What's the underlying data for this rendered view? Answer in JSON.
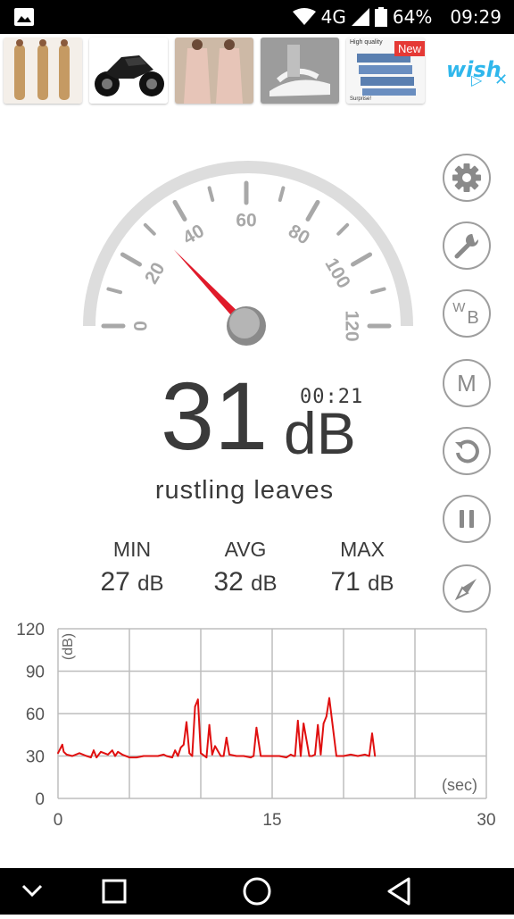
{
  "status_bar": {
    "network": "4G",
    "battery": "64%",
    "time": "09:29",
    "icons": [
      "gallery-icon",
      "wifi-icon",
      "signal-icon",
      "battery-icon"
    ]
  },
  "ad_banner": {
    "new_badge": "New",
    "high_quality_text": "High quality",
    "surprise_text": "Surprise!",
    "brand": "wish",
    "icons": [
      "adchoices-icon",
      "close-icon"
    ]
  },
  "gauge": {
    "min": 0,
    "max": 120,
    "tick_labels": [
      "0",
      "20",
      "40",
      "60",
      "80",
      "100",
      "120"
    ],
    "needle_value": 31
  },
  "reading": {
    "value": "31",
    "unit": "dB",
    "timer": "00:21",
    "description": "rustling leaves"
  },
  "stats": {
    "min_label": "MIN",
    "min_value": "27",
    "min_unit": "dB",
    "avg_label": "AVG",
    "avg_value": "32",
    "avg_unit": "dB",
    "max_label": "MAX",
    "max_value": "71",
    "max_unit": "dB"
  },
  "side_buttons": [
    "settings",
    "wrench",
    "WB",
    "M",
    "reset",
    "pause",
    "compass"
  ],
  "side_labels": {
    "wb_w": "W",
    "wb_b": "B",
    "m": "M"
  },
  "chart_data": {
    "type": "line",
    "y_tick_labels": [
      "120",
      "90",
      "60",
      "30",
      "0"
    ],
    "x_tick_labels": [
      "0",
      "15",
      "30"
    ],
    "ylabel": "(dB)",
    "xlabel": "(sec)",
    "xlim": [
      0,
      30
    ],
    "ylim": [
      0,
      120
    ],
    "grid": true,
    "color": "#e01010",
    "series": [
      {
        "x": [
          0,
          0.3,
          0.4,
          0.6,
          1.0,
          1.5,
          2.0,
          2.3,
          2.5,
          2.7,
          3.0,
          3.5,
          3.8,
          4.0,
          4.2,
          4.5,
          5.0,
          5.5,
          6.0,
          6.5,
          7.0,
          7.4,
          7.6,
          8.0,
          8.2,
          8.4,
          8.6,
          8.8,
          9.0,
          9.2,
          9.4,
          9.6,
          9.8,
          10.0,
          10.4,
          10.6,
          10.8,
          11.0,
          11.4,
          11.6,
          11.8,
          12.0,
          12.5,
          13.0,
          13.5,
          13.7,
          13.9,
          14.2,
          15.0,
          15.5,
          16.0,
          16.3,
          16.5,
          16.6,
          16.8,
          17.0,
          17.2,
          17.6,
          17.8,
          18.0,
          18.2,
          18.4,
          18.6,
          18.8,
          19.0,
          19.5,
          20.0,
          20.5,
          21.0,
          21.5,
          21.8,
          22.0,
          22.2
        ],
        "y": [
          32,
          38,
          33,
          31,
          30,
          32,
          30,
          29,
          34,
          29,
          33,
          31,
          34,
          30,
          33,
          31,
          29,
          29,
          30,
          30,
          30,
          31,
          30,
          29,
          34,
          30,
          36,
          38,
          54,
          32,
          30,
          65,
          70,
          32,
          29,
          52,
          31,
          37,
          30,
          30,
          43,
          31,
          30,
          30,
          29,
          30,
          50,
          30,
          30,
          30,
          29,
          31,
          30,
          30,
          55,
          30,
          53,
          30,
          30,
          31,
          52,
          31,
          53,
          58,
          71,
          30,
          30,
          31,
          30,
          31,
          30,
          46,
          30
        ]
      }
    ]
  },
  "nav_icons": [
    "back-icon",
    "home-icon",
    "recents-icon",
    "collapse-icon"
  ]
}
